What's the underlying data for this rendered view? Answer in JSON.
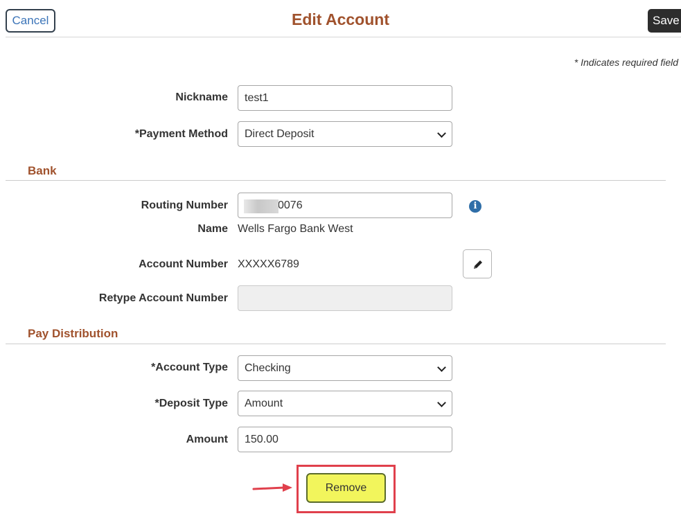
{
  "header": {
    "cancel_label": "Cancel",
    "title": "Edit Account",
    "save_label": "Save"
  },
  "required_note": "* Indicates required field",
  "form": {
    "nickname": {
      "label": "Nickname",
      "value": "test1"
    },
    "payment_method": {
      "label": "*Payment Method",
      "value": "Direct Deposit"
    }
  },
  "bank": {
    "section_title": "Bank",
    "routing_number": {
      "label": "Routing Number",
      "value_visible": "0076",
      "info_icon": "info-icon"
    },
    "name": {
      "label": "Name",
      "value": "Wells Fargo Bank West"
    },
    "account_number": {
      "label": "Account Number",
      "value": "XXXXX6789",
      "edit_icon": "pencil-icon"
    },
    "retype_account_number": {
      "label": "Retype Account Number",
      "value": ""
    }
  },
  "pay_distribution": {
    "section_title": "Pay Distribution",
    "account_type": {
      "label": "*Account Type",
      "value": "Checking"
    },
    "deposit_type": {
      "label": "*Deposit Type",
      "value": "Amount"
    },
    "amount": {
      "label": "Amount",
      "value": "150.00"
    }
  },
  "remove_label": "Remove",
  "colors": {
    "title": "#a0522d",
    "link": "#3b74b8",
    "save_bg": "#2d2d2d",
    "remove_bg": "#f2f55c",
    "highlight": "#e0404c",
    "info": "#2f6ea8"
  }
}
